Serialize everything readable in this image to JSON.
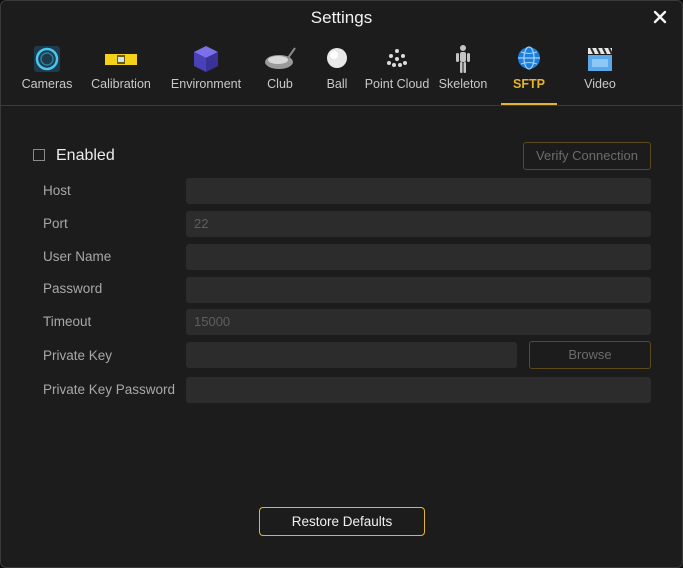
{
  "window": {
    "title": "Settings"
  },
  "tabs": [
    {
      "label": "Cameras",
      "icon": "camera-ring-icon"
    },
    {
      "label": "Calibration",
      "icon": "level-icon"
    },
    {
      "label": "Environment",
      "icon": "cube-icon"
    },
    {
      "label": "Club",
      "icon": "golf-club-icon"
    },
    {
      "label": "Ball",
      "icon": "ball-icon"
    },
    {
      "label": "Point Cloud",
      "icon": "point-cloud-icon"
    },
    {
      "label": "Skeleton",
      "icon": "skeleton-icon"
    },
    {
      "label": "SFTP",
      "icon": "globe-icon",
      "active": true
    },
    {
      "label": "Video",
      "icon": "clapperboard-icon"
    }
  ],
  "sftp": {
    "enabled_label": "Enabled",
    "enabled": false,
    "verify_label": "Verify Connection",
    "fields": {
      "host": {
        "label": "Host",
        "value": ""
      },
      "port": {
        "label": "Port",
        "value": "22"
      },
      "user_name": {
        "label": "User Name",
        "value": ""
      },
      "password": {
        "label": "Password",
        "value": ""
      },
      "timeout": {
        "label": "Timeout",
        "value": "15000"
      },
      "private_key": {
        "label": "Private Key",
        "value": ""
      },
      "private_key_password": {
        "label": "Private Key Password",
        "value": ""
      }
    },
    "browse_label": "Browse"
  },
  "footer": {
    "restore_label": "Restore Defaults"
  },
  "colors": {
    "accent": "#e6b42a",
    "background": "#1c1c1c",
    "field": "#2c2c2c"
  }
}
